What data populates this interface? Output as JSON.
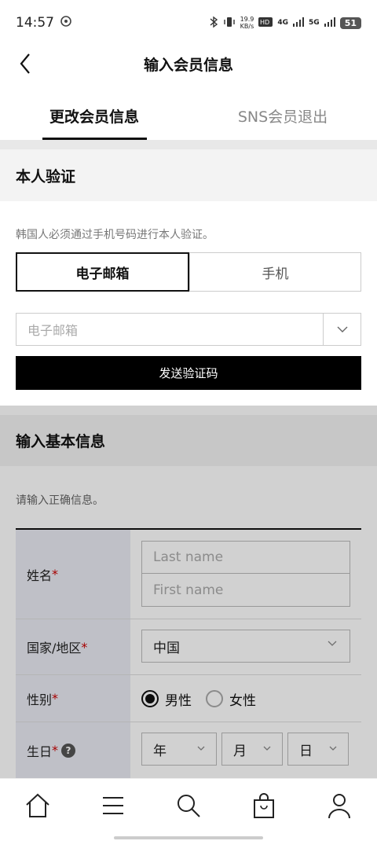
{
  "status_bar": {
    "time": "14:57",
    "net_speed_value": "19.9",
    "net_speed_unit": "KB/s",
    "sig1": "4G",
    "sig2": "5G",
    "battery": "51"
  },
  "header": {
    "title": "输入会员信息"
  },
  "tabs": [
    {
      "label": "更改会员信息"
    },
    {
      "label": "SNS会员退出"
    }
  ],
  "verify": {
    "title": "本人验证",
    "hint": "韩国人必须通过手机号码进行本人验证。",
    "options": [
      "电子邮箱",
      "手机"
    ],
    "email_placeholder": "电子邮箱",
    "send_button": "发送验证码"
  },
  "basic": {
    "title": "输入基本信息",
    "hint": "请输入正确信息。",
    "name_label": "姓名",
    "last_name_placeholder": "Last name",
    "first_name_placeholder": "First name",
    "country_label": "国家/地区",
    "country_value": "中国",
    "gender_label": "性别",
    "gender_male": "男性",
    "gender_female": "女性",
    "birthday_label": "生日",
    "help_mark": "?",
    "year": "年",
    "month": "月",
    "day": "日",
    "required_mark": "*"
  }
}
